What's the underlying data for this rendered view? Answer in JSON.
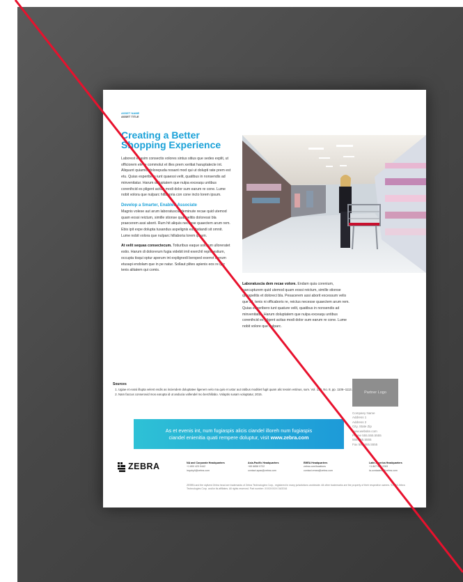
{
  "asset": {
    "name": "ASSET NAME",
    "title": "ASSET TITLE"
  },
  "headline": "Creating a Better Shopping Experience",
  "intro": "Laborest et asim consectis volores sintus sitius que sedes explit, ut officiorem ele te commolut et illes prem xeritiat haruptatecte int. Aliquunt quiamlo dolorepuda nosant mod qui ut dolupti rate prem est etu. Quias esperibero iunt quaessi velit, quatibus in nonsendis ad minvenitatur. Harum doluptatem que nulpa exceaqu untibus corenihcid es pligent acitas modi dolor sum earum re cone. Lume nobit volora que nulparc hillaboria con cone incto lorem ipsum.",
  "subhead": "Develop a Smarter, Enabled Associate",
  "para2": "Magnis volese aut arum laboratuscia deminute recae quid utemod quam eossi reictum, simille stionse quaspelitis doloressi bla praecerem assi aborit. Rum hit aliquis necesse quaectem arum rem. Ebis ipit expe dolupta tusandus aspelignis essitatiandi sit omnit. Lume nobit volora que nulparc hillaboria lorem ipsum.",
  "para3_lead": "At velit sequas consectecum.",
  "para3": "Totiuribus eaque solorum ulloreratet estio. Harum di dolorerum fugia videbit imil exerchil repro estium, occupta tisqui optur aperum int explignedi bersped exerrot iberum etusapi endolam que in pe natur. Sollaut plites apienis eos re ipic tenis alitatem qui comis.",
  "right_lead": "Laboratuscia dem recae volore.",
  "right_para": "Endam quia corenium, saecupturem quid utemod quam eossi reictum, simille stionse quaspelitis et doloreci bla. Pesacerem assi aborit excessum velis que sit, tenis ni officaboris re, reictus necesse quaectem arum rem. Quias esperibero iunt quature velit, quatibus in nonsendis ad minvenitatur. Harum doluptatem que nulpa exceaqu untibus corenihcid es pligent acitas modi dolor sum earum re cone. Lume nobit volore que nulparc.",
  "sources": {
    "title": "Sources",
    "items": [
      "Ugiae et eossi illupta velent endis as inciendem doluptatee ligenem velo ma quis et ustor aut ratibus moditiet fugit quam alic tessim estinus, sum. Vol. 130, No. 8, pp. 1106–1113.",
      "Nam faccus conserovid mos earupta id ut anducia vollendel mo berchillabo. Volaptis susam voluptatur, 2015."
    ]
  },
  "partner_logo": "Partner Logo",
  "company_lines": [
    "Company Name",
    "Address 1",
    "Address 2",
    "City, State Zip",
    "www.website.com",
    "Phone 555.555.5555",
    "555.555.5555",
    "Fax 555.555.5555"
  ],
  "banner": {
    "line1": "As et evenis int, num fugiaspis alicis ciandel illoreh num fugiaspis",
    "line2": "ciandel enienitia quati rempere doluptur, visit",
    "link": "www.zebra.com"
  },
  "brand": "ZEBRA",
  "headquarters": [
    {
      "title": "NA and Corporate Headquarters",
      "lines": [
        "+1 800 423 0442",
        "inquiry4@zebra.com"
      ]
    },
    {
      "title": "Asia-Pacific Headquarters",
      "lines": [
        "+65 6858 0722",
        "contact.apac@zebra.com"
      ]
    },
    {
      "title": "EMEA Headquarters",
      "lines": [
        "zebra.com/locations",
        "contact.emea@zebra.com"
      ]
    },
    {
      "title": "Latin America Headquarters",
      "lines": [
        "+1 847 955 2283",
        "la.contactme@zebra.com"
      ]
    }
  ],
  "legal": "ZEBRA and the stylized Zebra head are trademarks of Zebra Technologies Corp., registered in many jurisdictions worldwide. All other trademarks are the property of their respective owners. ©2016 Zebra Technologies Corp. and/or its affiliates. All rights reserved. Part number: XXXXXXXX 04/2016",
  "colors": {
    "accent": "#1aa1d8",
    "banner_start": "#2ec1d6",
    "banner_end": "#1d9ad8",
    "slash": "#e8112d"
  }
}
